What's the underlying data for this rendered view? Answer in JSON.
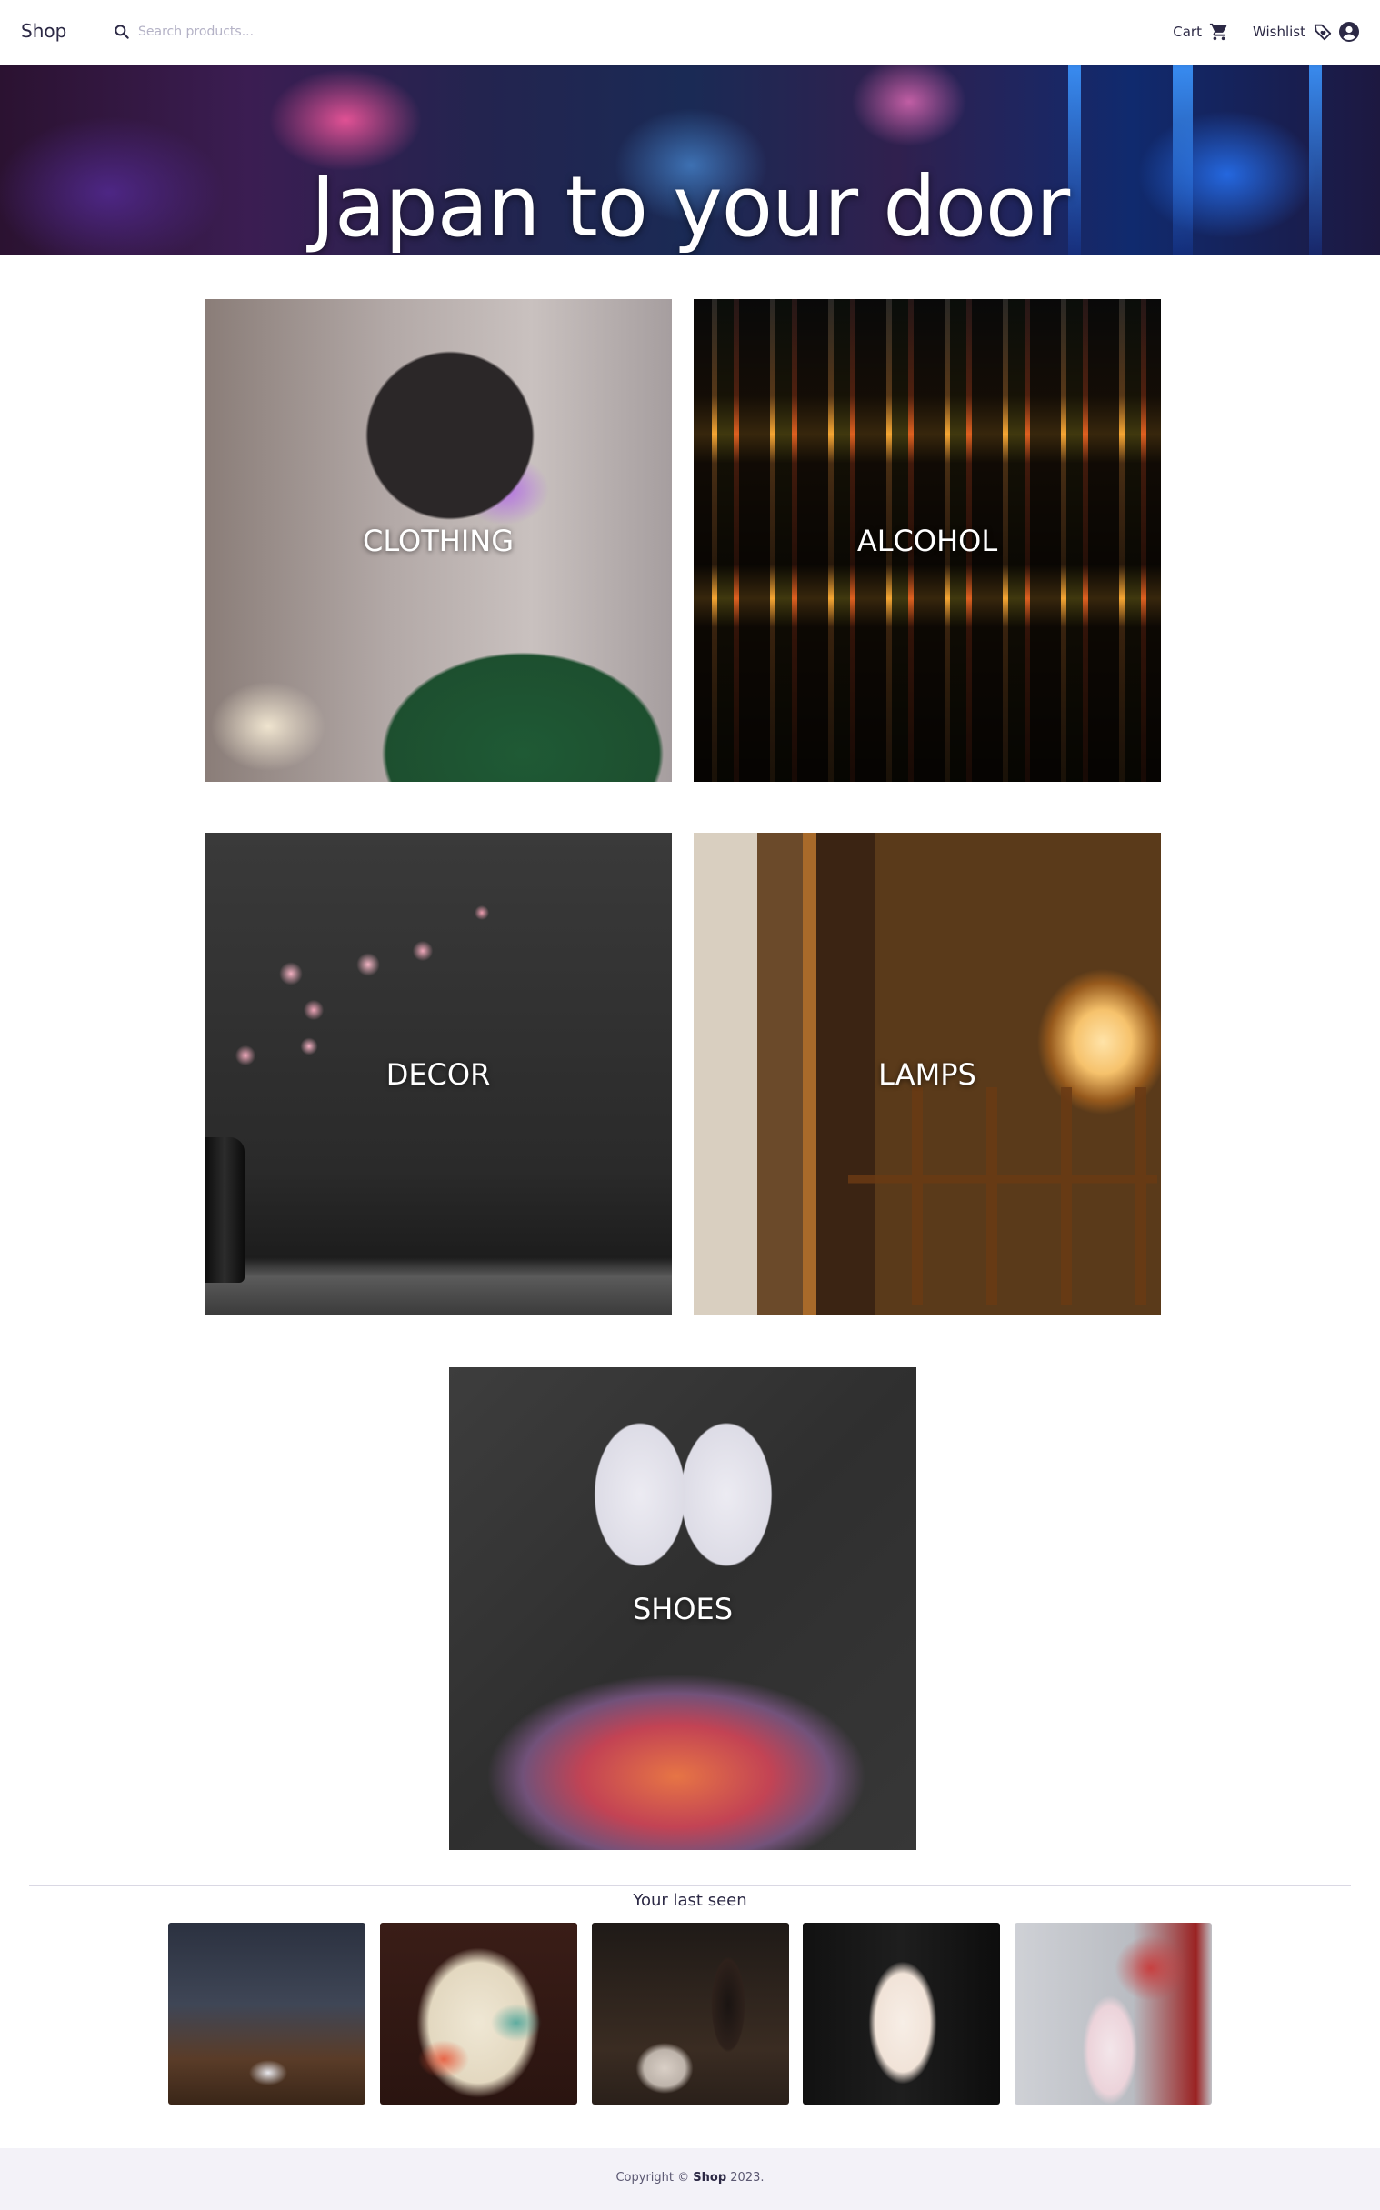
{
  "header": {
    "brand": "Shop",
    "search_placeholder": "Search products...",
    "cart_label": "Cart",
    "wishlist_label": "Wishlist"
  },
  "icons": {
    "search": "search-icon",
    "cart": "cart-icon",
    "wishlist": "tag-heart-icon",
    "account": "account-circle-icon"
  },
  "colors": {
    "text": "#2c2945",
    "placeholder": "#b4b2c6",
    "footer_bg": "#f3f2f8"
  },
  "hero": {
    "title": "Japan to your door"
  },
  "categories": [
    {
      "label": "CLOTHING"
    },
    {
      "label": "ALCOHOL"
    },
    {
      "label": "DECOR"
    },
    {
      "label": "LAMPS"
    },
    {
      "label": "SHOES"
    }
  ],
  "last_seen": {
    "title": "Your last seen",
    "item_count": 5
  },
  "footer": {
    "prefix": "Copyright ©",
    "brand": "Shop",
    "suffix": "2023."
  }
}
